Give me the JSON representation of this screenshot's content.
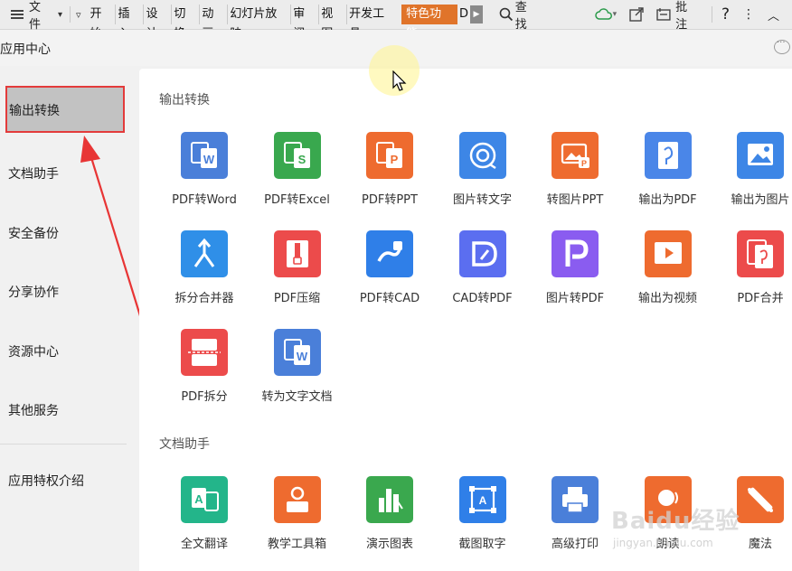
{
  "menubar": {
    "file": "文件",
    "tabs": [
      "开始",
      "插入",
      "设计",
      "切换",
      "动画",
      "幻灯片放映",
      "审阅",
      "视图",
      "开发工具"
    ],
    "special_tab": "特色功能",
    "search": "查找",
    "comment": "批注",
    "help": "?"
  },
  "header": {
    "title": "应用中心"
  },
  "sidebar": {
    "items": [
      "输出转换",
      "文档助手",
      "安全备份",
      "分享协作",
      "资源中心",
      "其他服务",
      "应用特权介绍"
    ]
  },
  "sections": [
    {
      "title": "输出转换",
      "tiles": [
        {
          "label": "PDF转Word",
          "icon": "pdf-to-word-icon",
          "color": "#4a7fd9"
        },
        {
          "label": "PDF转Excel",
          "icon": "pdf-to-excel-icon",
          "color": "#39a84e"
        },
        {
          "label": "PDF转PPT",
          "icon": "pdf-to-ppt-icon",
          "color": "#ee6b2f"
        },
        {
          "label": "图片转文字",
          "icon": "image-to-text-icon",
          "color": "#3d86e6"
        },
        {
          "label": "转图片PPT",
          "icon": "to-image-ppt-icon",
          "color": "#ee6b2f"
        },
        {
          "label": "输出为PDF",
          "icon": "export-pdf-icon",
          "color": "#4a86e8"
        },
        {
          "label": "输出为图片",
          "icon": "export-image-icon",
          "color": "#3d86e6"
        },
        {
          "label": "拆分合并器",
          "icon": "split-merge-icon",
          "color": "#2f8fe8"
        },
        {
          "label": "PDF压缩",
          "icon": "pdf-compress-icon",
          "color": "#ec4b4b"
        },
        {
          "label": "PDF转CAD",
          "icon": "pdf-to-cad-icon",
          "color": "#2f7fe8"
        },
        {
          "label": "CAD转PDF",
          "icon": "cad-to-pdf-icon",
          "color": "#5b6ef0"
        },
        {
          "label": "图片转PDF",
          "icon": "image-to-pdf-icon",
          "color": "#8a5cf0"
        },
        {
          "label": "输出为视频",
          "icon": "export-video-icon",
          "color": "#ee6b2f"
        },
        {
          "label": "PDF合并",
          "icon": "pdf-merge-icon",
          "color": "#ec4b4b"
        },
        {
          "label": "PDF拆分",
          "icon": "pdf-split-icon",
          "color": "#ec4b4b"
        },
        {
          "label": "转为文字文档",
          "icon": "to-text-doc-icon",
          "color": "#4a7fd9"
        }
      ]
    },
    {
      "title": "文档助手",
      "tiles": [
        {
          "label": "全文翻译",
          "icon": "translate-icon",
          "color": "#23b58a"
        },
        {
          "label": "教学工具箱",
          "icon": "teaching-toolbox-icon",
          "color": "#ee6b2f"
        },
        {
          "label": "演示图表",
          "icon": "presentation-chart-icon",
          "color": "#3aa84e"
        },
        {
          "label": "截图取字",
          "icon": "screenshot-ocr-icon",
          "color": "#2f7fe8"
        },
        {
          "label": "高级打印",
          "icon": "advanced-print-icon",
          "color": "#4a7fd9"
        },
        {
          "label": "朗读",
          "icon": "read-aloud-icon",
          "color": "#ee6b2f"
        },
        {
          "label": "魔法",
          "icon": "magic-icon",
          "color": "#ee6b2f"
        }
      ]
    }
  ],
  "watermark": {
    "text": "Baidu经验",
    "sub": "jingyan.baidu.com"
  }
}
